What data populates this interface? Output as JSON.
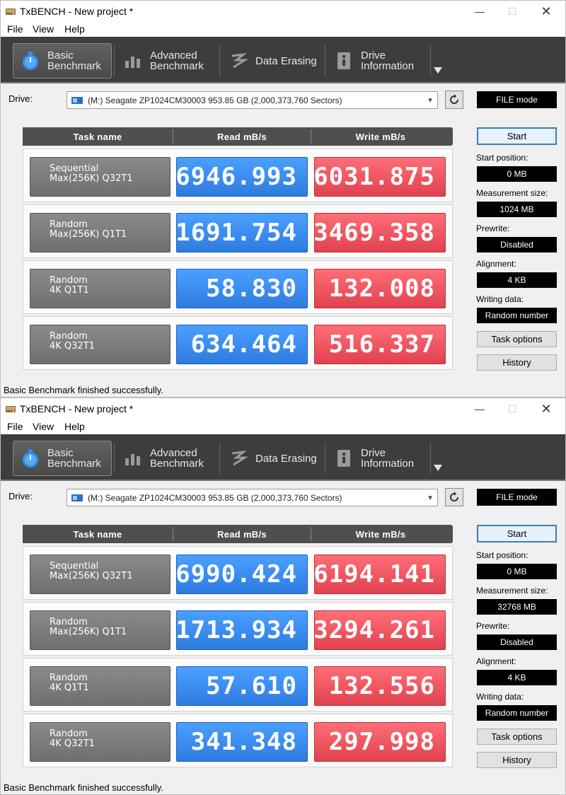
{
  "windows": [
    {
      "title": "TxBENCH - New project *",
      "menu": [
        "File",
        "View",
        "Help"
      ],
      "tabs": [
        {
          "line1": "Basic",
          "line2": "Benchmark",
          "active": true
        },
        {
          "line1": "Advanced",
          "line2": "Benchmark",
          "active": false
        },
        {
          "line1": "Data Erasing",
          "line2": "",
          "active": false
        },
        {
          "line1": "Drive",
          "line2": "Information",
          "active": false
        }
      ],
      "drive_label": "Drive:",
      "drive_value": "(M:) Seagate ZP1024CM30003  953.85 GB (2,000,373,760 Sectors)",
      "mode": "FILE mode",
      "headers": {
        "task": "Task name",
        "read": "Read mB/s",
        "write": "Write mB/s"
      },
      "rows": [
        {
          "name1": "Sequential",
          "name2": "Max(256K) Q32T1",
          "read": "6946.993",
          "write": "6031.875"
        },
        {
          "name1": "Random",
          "name2": "Max(256K) Q1T1",
          "read": "1691.754",
          "write": "3469.358"
        },
        {
          "name1": "Random",
          "name2": "4K Q1T1",
          "read": "58.830",
          "write": "132.008"
        },
        {
          "name1": "Random",
          "name2": "4K Q32T1",
          "read": "634.464",
          "write": "516.337"
        }
      ],
      "start_label": "Start",
      "start_position_label": "Start position:",
      "start_position": "0 MB",
      "measurement_size_label": "Measurement size:",
      "measurement_size": "1024 MB",
      "prewrite_label": "Prewrite:",
      "prewrite": "Disabled",
      "alignment_label": "Alignment:",
      "alignment": "4 KB",
      "writing_data_label": "Writing data:",
      "writing_data": "Random number",
      "task_options_label": "Task options",
      "history_label": "History",
      "status": "Basic Benchmark finished successfully."
    },
    {
      "title": "TxBENCH - New project *",
      "menu": [
        "File",
        "View",
        "Help"
      ],
      "tabs": [
        {
          "line1": "Basic",
          "line2": "Benchmark",
          "active": true
        },
        {
          "line1": "Advanced",
          "line2": "Benchmark",
          "active": false
        },
        {
          "line1": "Data Erasing",
          "line2": "",
          "active": false
        },
        {
          "line1": "Drive",
          "line2": "Information",
          "active": false
        }
      ],
      "drive_label": "Drive:",
      "drive_value": "(M:) Seagate ZP1024CM30003  953.85 GB (2,000,373,760 Sectors)",
      "mode": "FILE mode",
      "headers": {
        "task": "Task name",
        "read": "Read mB/s",
        "write": "Write mB/s"
      },
      "rows": [
        {
          "name1": "Sequential",
          "name2": "Max(256K) Q32T1",
          "read": "6990.424",
          "write": "6194.141"
        },
        {
          "name1": "Random",
          "name2": "Max(256K) Q1T1",
          "read": "1713.934",
          "write": "3294.261"
        },
        {
          "name1": "Random",
          "name2": "4K Q1T1",
          "read": "57.610",
          "write": "132.556"
        },
        {
          "name1": "Random",
          "name2": "4K Q32T1",
          "read": "341.348",
          "write": "297.998"
        }
      ],
      "start_label": "Start",
      "start_position_label": "Start position:",
      "start_position": "0 MB",
      "measurement_size_label": "Measurement size:",
      "measurement_size": "32768 MB",
      "prewrite_label": "Prewrite:",
      "prewrite": "Disabled",
      "alignment_label": "Alignment:",
      "alignment": "4 KB",
      "writing_data_label": "Writing data:",
      "writing_data": "Random number",
      "task_options_label": "Task options",
      "history_label": "History",
      "status": "Basic Benchmark finished successfully."
    }
  ],
  "colors": {
    "read": "#3d8ef0",
    "write": "#ef5560",
    "toolbar": "#3d3d3d",
    "header": "#4f4f4f",
    "accent_border": "#3c7fb1"
  },
  "icons": {
    "app": "hdd-app-icon",
    "basic": "stopwatch-icon",
    "advanced": "bar-chart-icon",
    "erasing": "eraser-icon",
    "info": "drive-info-icon",
    "refresh": "refresh-icon",
    "dropdown": "chevron-down-icon",
    "toolbar_more": "triangle-down-icon"
  }
}
